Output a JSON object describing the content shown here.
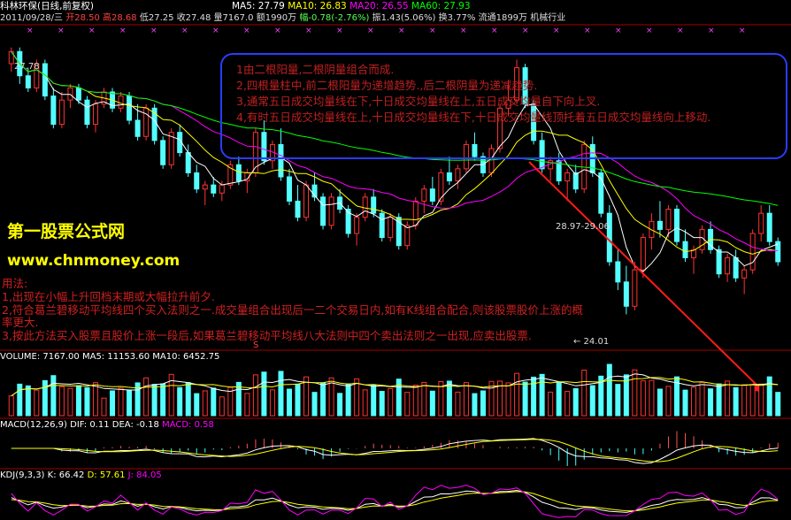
{
  "header": {
    "name": "科林环保(日线,前复权)",
    "date": "2011/09/28/三",
    "open": "开28.50",
    "high": "高28.68",
    "low": "低27.25",
    "close": "收27.48",
    "volume": "量7167.0",
    "amount": "额1990万",
    "change": "幅-0.78(-2.76%)",
    "amplitude": "振1.43(5.06%)",
    "turnover": "换3.77%",
    "float": "流通1899万",
    "industry": "机械行业"
  },
  "ma_bar": {
    "ma5": "MA5: 27.79",
    "ma10": "MA10: 26.83",
    "ma20": "MA20: 26.55",
    "ma60": "MA60: 27.93"
  },
  "colors": {
    "ma5": "#ffffff",
    "ma10": "#ffff00",
    "ma20": "#ff00ff",
    "ma60": "#00ff00",
    "up": "#ff3232",
    "down": "#54ffff",
    "box": "#2a3cff",
    "note": "#c02020"
  },
  "notes": [
    "1由二根阳量,二根阴量组合而成.",
    "2,四根量柱中,前二根阳量为递增趋势.,后二根阴量为递减趋势.",
    "3,通常五日成交均量线在下,十日成交均量线在上,五日成交均量自下向上叉.",
    "4,有时五日成交均量线在上,十日成交均量线在下,十日成交均量线顶托着五日成交均量线向上移动."
  ],
  "brand": {
    "name": "第一股票公式网",
    "url": "www.chnmoney.com"
  },
  "usage": [
    "用法:",
    "1,出现在小幅上升回档末期或大幅拉升前夕.",
    "2,符合葛兰碧移动平均线四个买入法则之一.成交量组合出现后一二个交易日内,如有K线组合配合,则该股票股价上涨的概",
    "率更大.",
    "3,按此方法买入股票且股价上涨一段后,如果葛兰碧移动平均线八大法则中四个卖出法则之一出现,应卖出股票."
  ],
  "price_labels": {
    "high_mark": "27.78",
    "range_mark": "28.97-29.06",
    "low_mark": "← 24.01",
    "s_mark": "S"
  },
  "volume_bar": {
    "label": "VOLUME: 7167.00",
    "ma5": "MA5: 11153.60",
    "ma10": "MA10: 6452.75"
  },
  "macd_bar": {
    "label": "MACD(12,26,9)",
    "dif": "DIF: 0.11",
    "dea": "DEA: -0.18",
    "macd": "MACD: 0.58"
  },
  "kdj_bar": {
    "label": "KDJ(9,3,3)",
    "k": "K: 66.42",
    "d": "D: 57.61",
    "j": "J: 84.05"
  },
  "chart_data": {
    "type": "candlestick",
    "candles": [
      [
        27.5,
        27.9,
        27.3,
        27.8
      ],
      [
        27.8,
        27.9,
        27.0,
        27.2
      ],
      [
        27.2,
        27.4,
        26.8,
        26.9
      ],
      [
        26.9,
        27.6,
        26.8,
        27.5
      ],
      [
        27.5,
        27.6,
        26.6,
        26.7
      ],
      [
        26.7,
        26.9,
        25.9,
        26.0
      ],
      [
        26.0,
        26.8,
        25.9,
        26.6
      ],
      [
        26.6,
        27.0,
        26.4,
        26.9
      ],
      [
        26.9,
        27.0,
        26.5,
        26.6
      ],
      [
        26.6,
        26.7,
        25.9,
        26.0
      ],
      [
        26.0,
        26.6,
        25.8,
        26.5
      ],
      [
        26.5,
        26.9,
        26.4,
        26.8
      ],
      [
        26.8,
        26.9,
        26.3,
        26.4
      ],
      [
        26.4,
        26.8,
        26.3,
        26.7
      ],
      [
        26.7,
        26.8,
        26.0,
        26.1
      ],
      [
        26.1,
        26.5,
        25.6,
        25.7
      ],
      [
        25.7,
        26.5,
        25.6,
        26.4
      ],
      [
        26.4,
        26.5,
        25.5,
        25.6
      ],
      [
        25.6,
        25.7,
        24.9,
        25.0
      ],
      [
        25.0,
        25.9,
        24.9,
        25.8
      ],
      [
        25.8,
        26.0,
        25.2,
        25.3
      ],
      [
        25.3,
        25.5,
        24.7,
        24.8
      ],
      [
        24.8,
        25.0,
        24.3,
        24.4
      ],
      [
        24.4,
        24.6,
        24.0,
        24.5
      ],
      [
        24.5,
        24.7,
        24.2,
        24.3
      ],
      [
        24.3,
        24.6,
        24.1,
        24.5
      ],
      [
        24.5,
        25.1,
        24.4,
        25.0
      ],
      [
        25.0,
        25.2,
        24.5,
        24.6
      ],
      [
        24.6,
        24.9,
        24.3,
        24.8
      ],
      [
        24.8,
        25.9,
        24.7,
        25.8
      ],
      [
        25.8,
        26.1,
        25.0,
        25.1
      ],
      [
        25.1,
        25.6,
        24.9,
        25.5
      ],
      [
        25.5,
        25.9,
        24.6,
        24.7
      ],
      [
        24.7,
        24.9,
        24.0,
        24.1
      ],
      [
        24.1,
        24.5,
        23.6,
        23.7
      ],
      [
        23.7,
        24.6,
        23.6,
        24.5
      ],
      [
        24.5,
        24.8,
        24.1,
        24.2
      ],
      [
        24.2,
        24.3,
        23.4,
        23.5
      ],
      [
        23.5,
        24.3,
        23.4,
        24.2
      ],
      [
        24.2,
        24.4,
        23.8,
        23.9
      ],
      [
        23.9,
        24.0,
        23.2,
        23.3
      ],
      [
        23.3,
        23.8,
        23.0,
        23.7
      ],
      [
        23.7,
        24.3,
        23.6,
        24.2
      ],
      [
        24.2,
        24.4,
        23.7,
        23.8
      ],
      [
        23.8,
        23.9,
        23.1,
        23.2
      ],
      [
        23.2,
        23.8,
        23.1,
        23.7
      ],
      [
        23.7,
        23.8,
        22.9,
        23.0
      ],
      [
        23.0,
        23.6,
        22.9,
        23.5
      ],
      [
        23.5,
        24.2,
        23.4,
        24.1
      ],
      [
        24.1,
        24.5,
        23.8,
        24.4
      ],
      [
        24.4,
        24.7,
        24.0,
        24.1
      ],
      [
        24.1,
        24.9,
        24.0,
        24.8
      ],
      [
        24.8,
        25.2,
        24.5,
        24.6
      ],
      [
        24.6,
        25.0,
        24.4,
        24.9
      ],
      [
        24.9,
        25.6,
        24.8,
        25.5
      ],
      [
        25.5,
        25.8,
        25.1,
        25.2
      ],
      [
        25.2,
        25.3,
        24.7,
        24.8
      ],
      [
        24.8,
        25.5,
        24.7,
        25.4
      ],
      [
        25.4,
        26.5,
        25.3,
        26.4
      ],
      [
        26.4,
        27.1,
        26.2,
        26.6
      ],
      [
        26.6,
        27.6,
        26.5,
        27.4
      ],
      [
        27.4,
        27.5,
        26.4,
        26.5
      ],
      [
        26.5,
        26.6,
        25.5,
        25.6
      ],
      [
        25.6,
        25.8,
        24.8,
        24.9
      ],
      [
        24.9,
        25.2,
        24.6,
        25.1
      ],
      [
        25.1,
        25.3,
        24.5,
        24.6
      ],
      [
        24.6,
        24.9,
        24.1,
        24.8
      ],
      [
        24.8,
        25.0,
        24.3,
        24.4
      ],
      [
        24.4,
        25.6,
        24.3,
        25.5
      ],
      [
        25.5,
        25.7,
        24.7,
        24.8
      ],
      [
        24.8,
        24.9,
        23.7,
        23.8
      ],
      [
        23.8,
        24.0,
        22.5,
        22.6
      ],
      [
        22.6,
        22.9,
        21.9,
        22.1
      ],
      [
        22.1,
        22.5,
        21.3,
        21.5
      ],
      [
        21.5,
        22.6,
        21.4,
        22.4
      ],
      [
        22.4,
        23.3,
        22.2,
        23.2
      ],
      [
        23.2,
        23.8,
        22.9,
        23.6
      ],
      [
        23.6,
        24.1,
        23.2,
        23.4
      ],
      [
        23.4,
        24.0,
        23.2,
        23.9
      ],
      [
        23.9,
        24.0,
        23.0,
        23.1
      ],
      [
        23.1,
        23.4,
        22.6,
        22.7
      ],
      [
        22.7,
        23.0,
        22.3,
        22.9
      ],
      [
        22.9,
        23.5,
        22.8,
        23.4
      ],
      [
        23.4,
        23.6,
        22.8,
        22.9
      ],
      [
        22.9,
        23.0,
        22.2,
        22.3
      ],
      [
        22.3,
        22.8,
        22.1,
        22.7
      ],
      [
        22.7,
        22.9,
        22.1,
        22.2
      ],
      [
        22.2,
        22.5,
        21.8,
        22.4
      ],
      [
        22.4,
        23.4,
        22.3,
        23.3
      ],
      [
        23.3,
        24.0,
        23.1,
        23.8
      ],
      [
        23.8,
        24.0,
        23.0,
        23.1
      ],
      [
        23.1,
        23.2,
        22.5,
        22.6
      ]
    ]
  }
}
